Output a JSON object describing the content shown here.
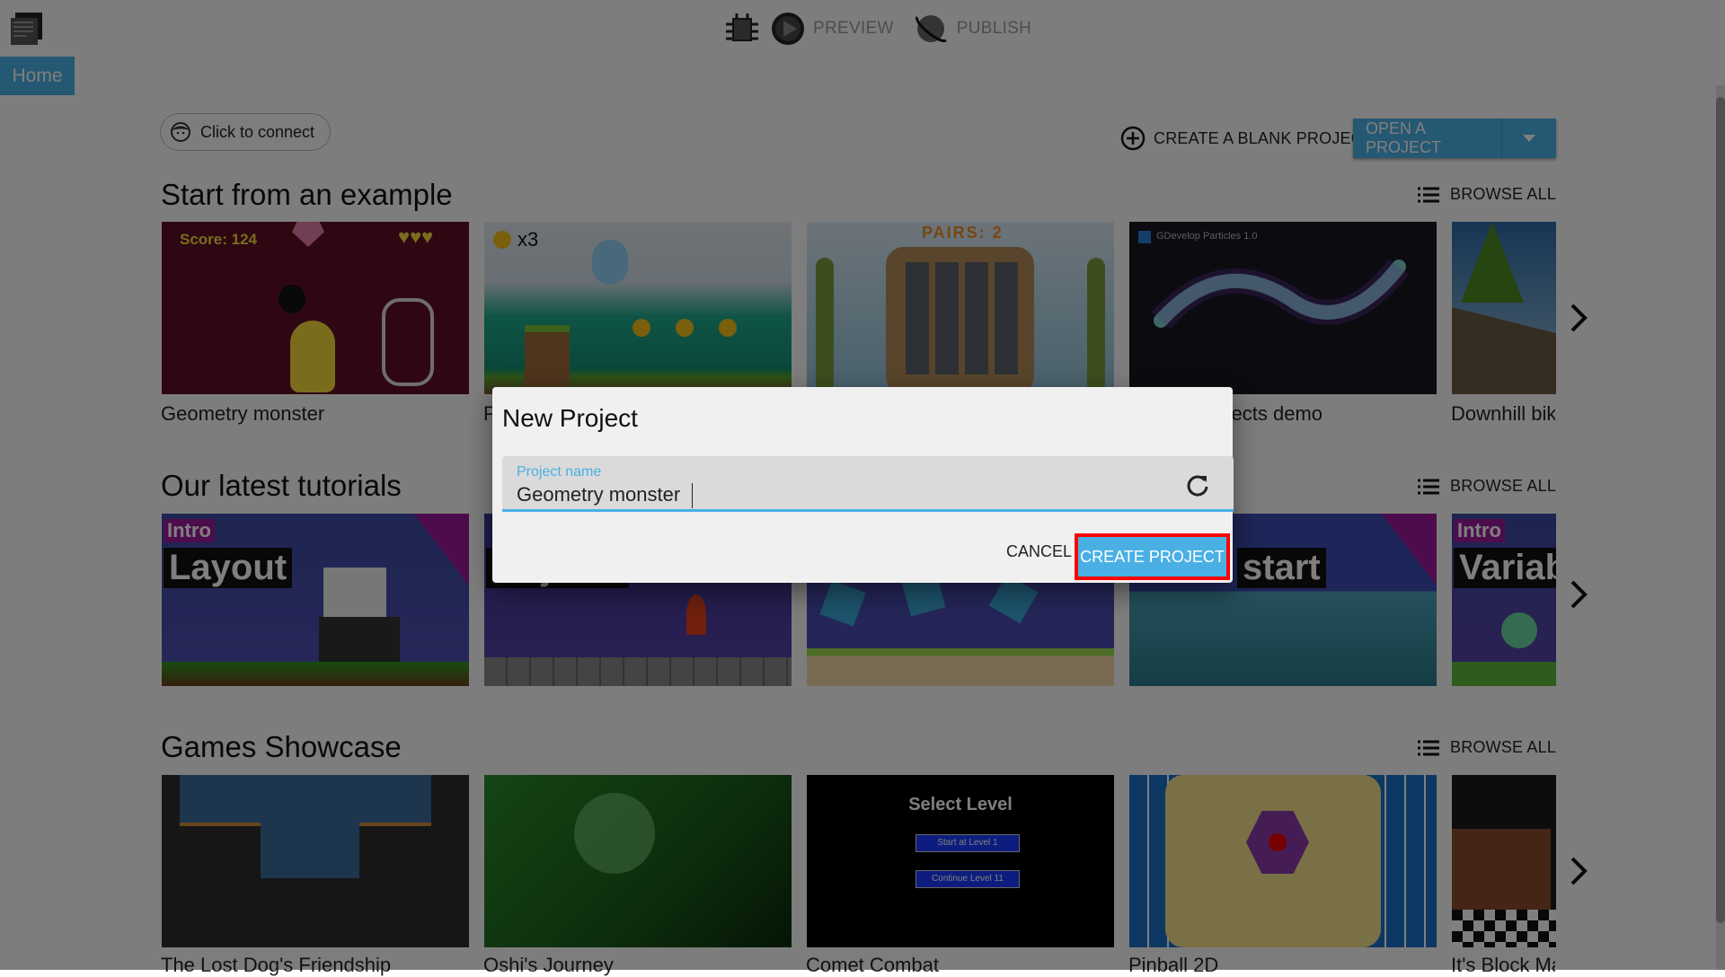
{
  "toolbar": {
    "debug_icon": "bug-icon",
    "preview_label": "PREVIEW",
    "publish_label": "PUBLISH"
  },
  "tabs": [
    {
      "label": "Home",
      "active": true
    }
  ],
  "connect": {
    "label": "Click to connect",
    "icon": "user-face-icon"
  },
  "actions": {
    "create_blank_label": "CREATE A BLANK PROJECT",
    "open_project_label": "OPEN A PROJECT"
  },
  "sections": {
    "examples": {
      "title": "Start from an example",
      "browse_all": "BROWSE ALL",
      "items": [
        {
          "label": "Geometry monster",
          "thumb_text": "Score: 124"
        },
        {
          "label": "Platformer",
          "thumb_text": "x3"
        },
        {
          "label": "",
          "thumb_text": "PAIRS: 2"
        },
        {
          "label": "Particles effects demo",
          "thumb_text": "GDevelop Particles 1.0"
        },
        {
          "label": "Downhill bike",
          "thumb_text": ""
        }
      ]
    },
    "tutorials": {
      "title": "Our latest tutorials",
      "browse_all": "BROWSE ALL",
      "items": [
        {
          "badge": "Intro",
          "heading": "Layout"
        },
        {
          "badge": "",
          "heading": "Objects"
        },
        {
          "badge": "",
          "heading": ""
        },
        {
          "badge": "",
          "heading": "start"
        },
        {
          "badge": "Intro",
          "heading": "Variab"
        }
      ]
    },
    "showcase": {
      "title": "Games Showcase",
      "browse_all": "BROWSE ALL",
      "items": [
        {
          "label": "The Lost Dog's Friendship"
        },
        {
          "label": "Oshi's Journey"
        },
        {
          "label": "Comet Combat",
          "thumb_title": "Select Level",
          "thumb_buttons": [
            "Start at Level 1",
            "Continue Level 11"
          ]
        },
        {
          "label": "Pinball 2D"
        },
        {
          "label": "It's Block Mania"
        }
      ]
    }
  },
  "dialog": {
    "title": "New Project",
    "field_label": "Project name",
    "field_value": "Geometry monster",
    "cancel_label": "CANCEL",
    "create_label": "CREATE PROJECT",
    "accent": "#4ab0e4",
    "highlight": "#ff0000"
  }
}
